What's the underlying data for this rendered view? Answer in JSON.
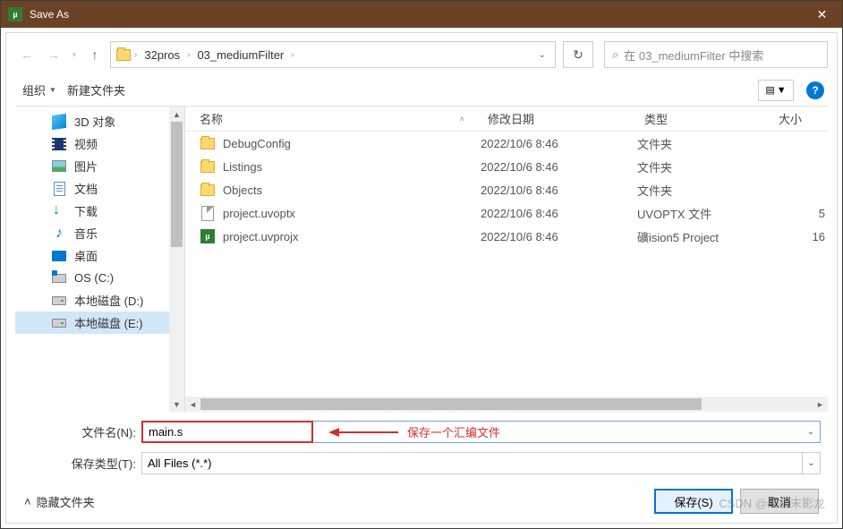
{
  "window": {
    "title": "Save As"
  },
  "nav": {
    "crumbs": [
      "32pros",
      "03_mediumFilter"
    ],
    "search_placeholder": "在 03_mediumFilter 中搜索"
  },
  "toolbar": {
    "organize": "组织",
    "new_folder": "新建文件夹"
  },
  "sidebar": {
    "items": [
      {
        "label": "3D 对象",
        "icon": "3d"
      },
      {
        "label": "视频",
        "icon": "video"
      },
      {
        "label": "图片",
        "icon": "pictures"
      },
      {
        "label": "文档",
        "icon": "documents"
      },
      {
        "label": "下载",
        "icon": "downloads"
      },
      {
        "label": "音乐",
        "icon": "music"
      },
      {
        "label": "桌面",
        "icon": "desktop"
      },
      {
        "label": "OS (C:)",
        "icon": "osdrive"
      },
      {
        "label": "本地磁盘 (D:)",
        "icon": "drive"
      },
      {
        "label": "本地磁盘 (E:)",
        "icon": "drive",
        "selected": true
      }
    ]
  },
  "columns": {
    "name": "名称",
    "date": "修改日期",
    "type": "类型",
    "size": "大小"
  },
  "files": [
    {
      "name": "DebugConfig",
      "date": "2022/10/6 8:46",
      "type": "文件夹",
      "size": "",
      "icon": "folder"
    },
    {
      "name": "Listings",
      "date": "2022/10/6 8:46",
      "type": "文件夹",
      "size": "",
      "icon": "folder"
    },
    {
      "name": "Objects",
      "date": "2022/10/6 8:46",
      "type": "文件夹",
      "size": "",
      "icon": "folder"
    },
    {
      "name": "project.uvoptx",
      "date": "2022/10/6 8:46",
      "type": "UVOPTX 文件",
      "size": "5",
      "icon": "file"
    },
    {
      "name": "project.uvprojx",
      "date": "2022/10/6 8:46",
      "type": "礦ision5 Project",
      "size": "16",
      "icon": "project"
    }
  ],
  "form": {
    "filename_label": "文件名(N):",
    "filename_value": "main.s",
    "filetype_label": "保存类型(T):",
    "filetype_value": "All Files (*.*)"
  },
  "annotation": "保存一个汇编文件",
  "bottom": {
    "hide_folders": "隐藏文件夹",
    "save": "保存(S)",
    "cancel": "取消"
  },
  "watermark": "CSDN @终极末影龙"
}
